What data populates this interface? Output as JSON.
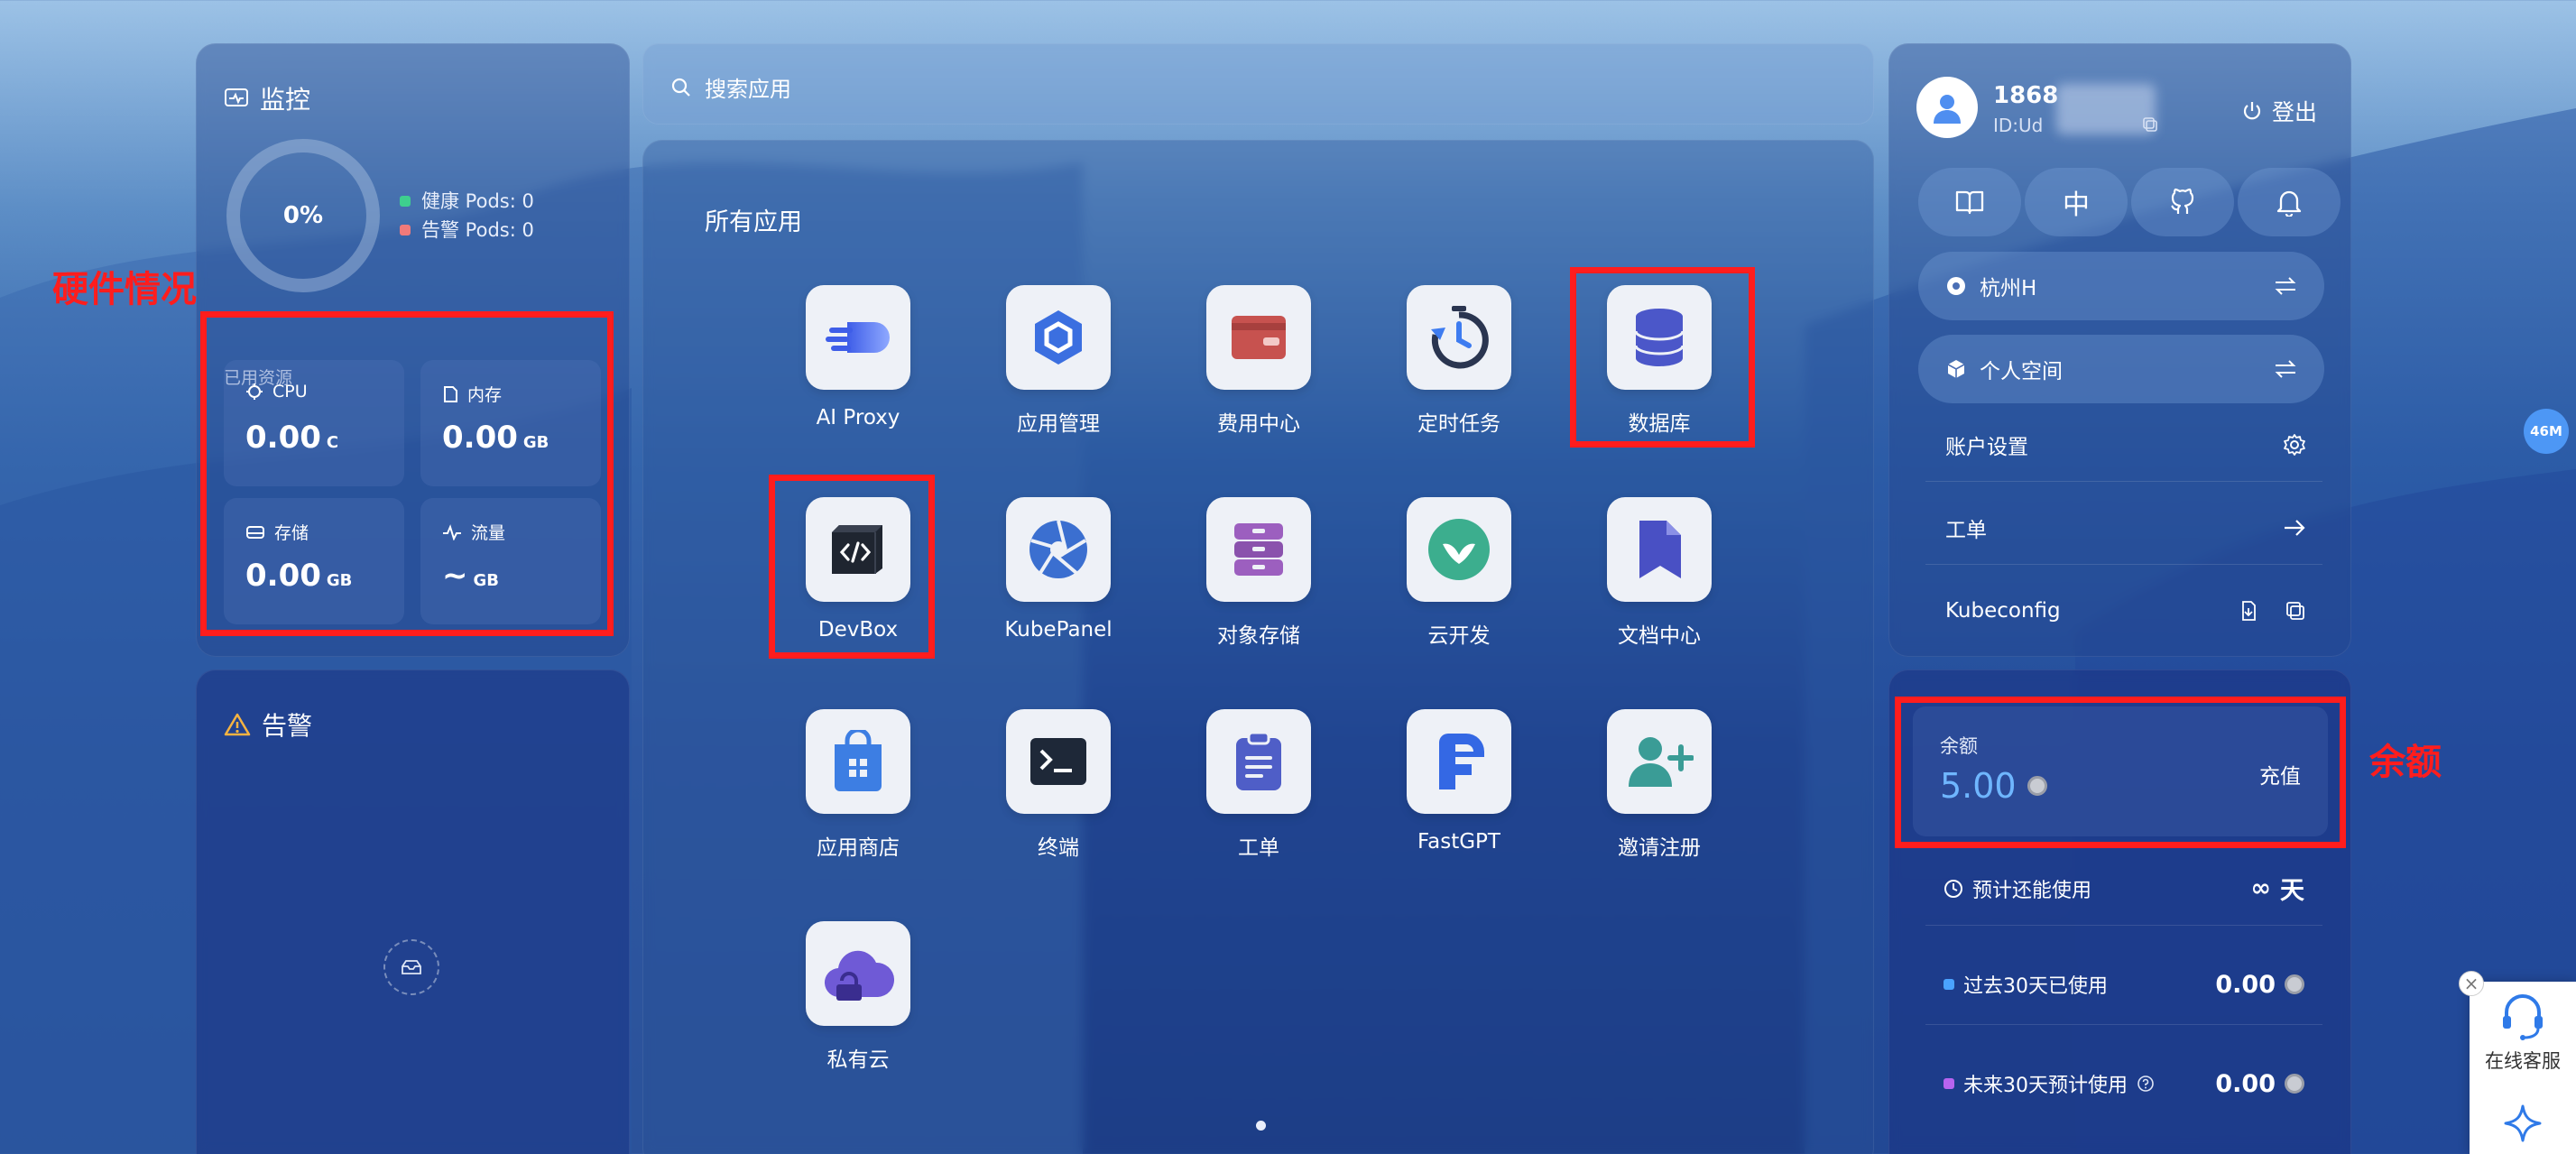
{
  "monitor": {
    "title": "监控",
    "percent": "0%",
    "healthy_pods": "健康 Pods: 0",
    "alert_pods": "告警 Pods: 0",
    "used_resources_title": "已用资源",
    "resources": [
      {
        "label": "CPU",
        "value": "0.00",
        "unit": "C"
      },
      {
        "label": "内存",
        "value": "0.00",
        "unit": "GB"
      },
      {
        "label": "存储",
        "value": "0.00",
        "unit": "GB"
      },
      {
        "label": "流量",
        "value": "~",
        "unit": "GB"
      }
    ],
    "colors": {
      "healthy": "#3ecf8e",
      "alert": "#f07a7a"
    }
  },
  "alerts": {
    "title": "告警"
  },
  "search": {
    "placeholder": "搜索应用"
  },
  "apps": {
    "title": "所有应用",
    "items": [
      {
        "label": "AI Proxy",
        "icon": "ai-proxy-icon"
      },
      {
        "label": "应用管理",
        "icon": "app-manage-icon"
      },
      {
        "label": "费用中心",
        "icon": "wallet-icon"
      },
      {
        "label": "定时任务",
        "icon": "timer-icon"
      },
      {
        "label": "数据库",
        "icon": "database-icon"
      },
      {
        "label": "DevBox",
        "icon": "devbox-icon"
      },
      {
        "label": "KubePanel",
        "icon": "kubepanel-icon"
      },
      {
        "label": "对象存储",
        "icon": "object-storage-icon"
      },
      {
        "label": "云开发",
        "icon": "cloud-dev-icon"
      },
      {
        "label": "文档中心",
        "icon": "docs-icon"
      },
      {
        "label": "应用商店",
        "icon": "app-store-icon"
      },
      {
        "label": "终端",
        "icon": "terminal-icon"
      },
      {
        "label": "工单",
        "icon": "ticket-icon"
      },
      {
        "label": "FastGPT",
        "icon": "fastgpt-icon"
      },
      {
        "label": "邀请注册",
        "icon": "invite-icon"
      },
      {
        "label": "私有云",
        "icon": "private-cloud-icon"
      }
    ]
  },
  "user": {
    "phone": "1868",
    "id": "ID:Ud",
    "logout": "登出",
    "lang_button": "中",
    "region": "杭州H",
    "workspace": "个人空间",
    "account_settings": "账户设置",
    "ticket": "工单",
    "kubeconfig": "Kubeconfig"
  },
  "balance": {
    "label": "余额",
    "value": "5.00",
    "recharge": "充值",
    "estimate_label": "预计还能使用",
    "estimate_value": "∞",
    "estimate_unit": "天",
    "past30_label": "过去30天已使用",
    "past30_value": "0.00",
    "next30_label": "未来30天预计使用",
    "next30_value": "0.00",
    "colors": {
      "past30": "#4aa3ff",
      "next30": "#b764f0"
    }
  },
  "annotations": {
    "hardware": "硬件情况",
    "balance": "余额",
    "color": "#ff1d1d"
  },
  "widgets": {
    "badge": "46M",
    "service_label": "在线客服",
    "close": "×"
  }
}
